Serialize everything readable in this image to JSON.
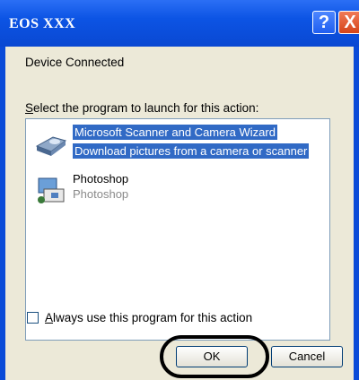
{
  "window": {
    "title": "EOS XXX"
  },
  "titlebar_buttons": {
    "help": "?",
    "close": "X"
  },
  "header": {
    "device_status": "Device Connected"
  },
  "prompt": {
    "prefix": "S",
    "rest": "elect the program to launch for this action:"
  },
  "programs": [
    {
      "name": "Microsoft Scanner and Camera Wizard",
      "description": "Download pictures from a camera or scanner",
      "icon": "scanner-camera-icon",
      "selected": true
    },
    {
      "name": "Photoshop",
      "description": "Photoshop",
      "icon": "photoshop-icon",
      "selected": false
    }
  ],
  "always_checkbox": {
    "prefix": "A",
    "rest": "lways use this program for this action",
    "checked": false
  },
  "buttons": {
    "ok": "OK",
    "cancel": "Cancel"
  },
  "colors": {
    "titlebar": "#0a4bd8",
    "selection": "#316ac5",
    "dialog_bg": "#ece9d8",
    "close_btn": "#d54418"
  }
}
